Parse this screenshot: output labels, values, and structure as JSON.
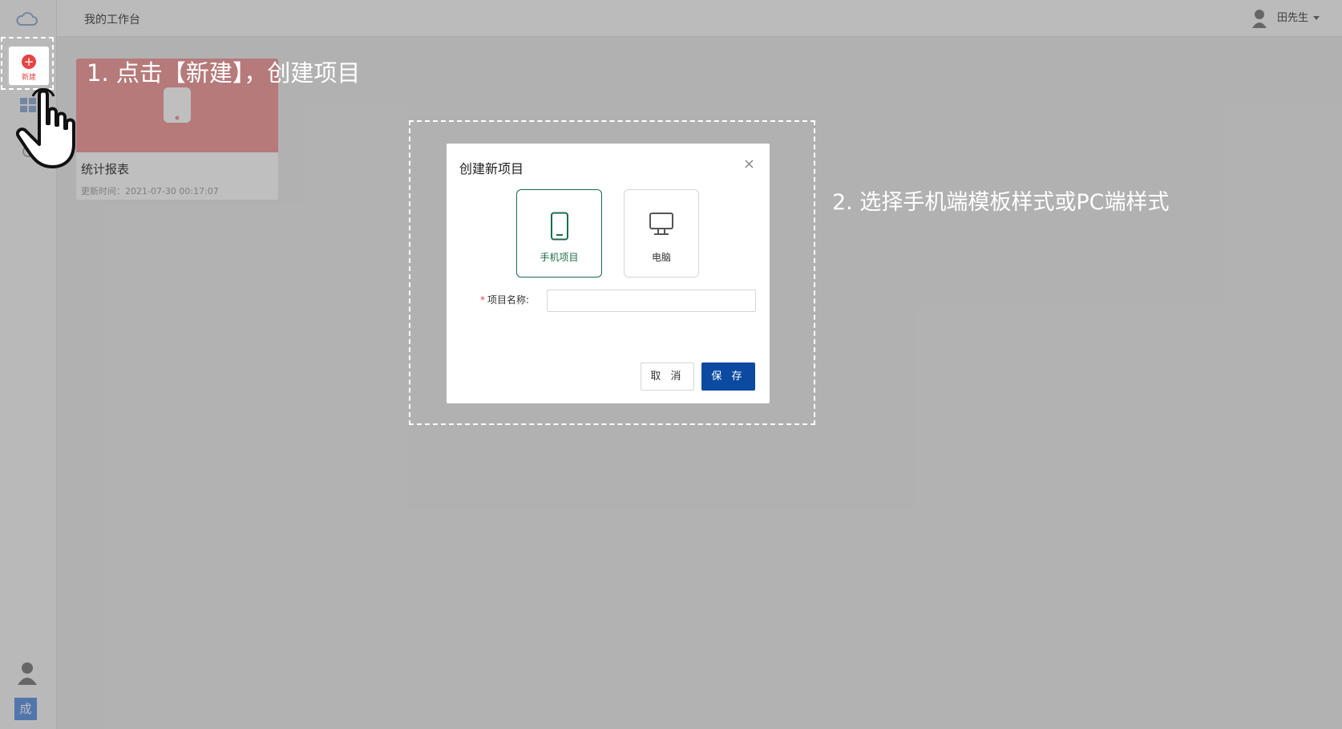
{
  "topbar": {
    "title": "我的工作台",
    "user_name": "田先生"
  },
  "sidebar": {
    "new_label": "新建",
    "badge": "成"
  },
  "card": {
    "title": "统计报表",
    "updated": "更新时间：2021-07-30 00:17:07"
  },
  "annotations": {
    "step1": "1. 点击【新建】，创建项目",
    "step2": "2. 选择手机端模板样式或PC端样式"
  },
  "dialog": {
    "title": "创建新项目",
    "options": [
      {
        "label": "手机项目",
        "icon": "phone-icon",
        "selected": true
      },
      {
        "label": "电脑",
        "icon": "monitor-icon",
        "selected": false
      }
    ],
    "required_mark": "*",
    "name_label": "项目名称:",
    "name_value": "",
    "cancel_label": "取 消",
    "save_label": "保 存",
    "close_symbol": "×"
  },
  "colors": {
    "accent": "#0b4aa0",
    "selected": "#1e6b4a",
    "danger": "#e54545"
  }
}
